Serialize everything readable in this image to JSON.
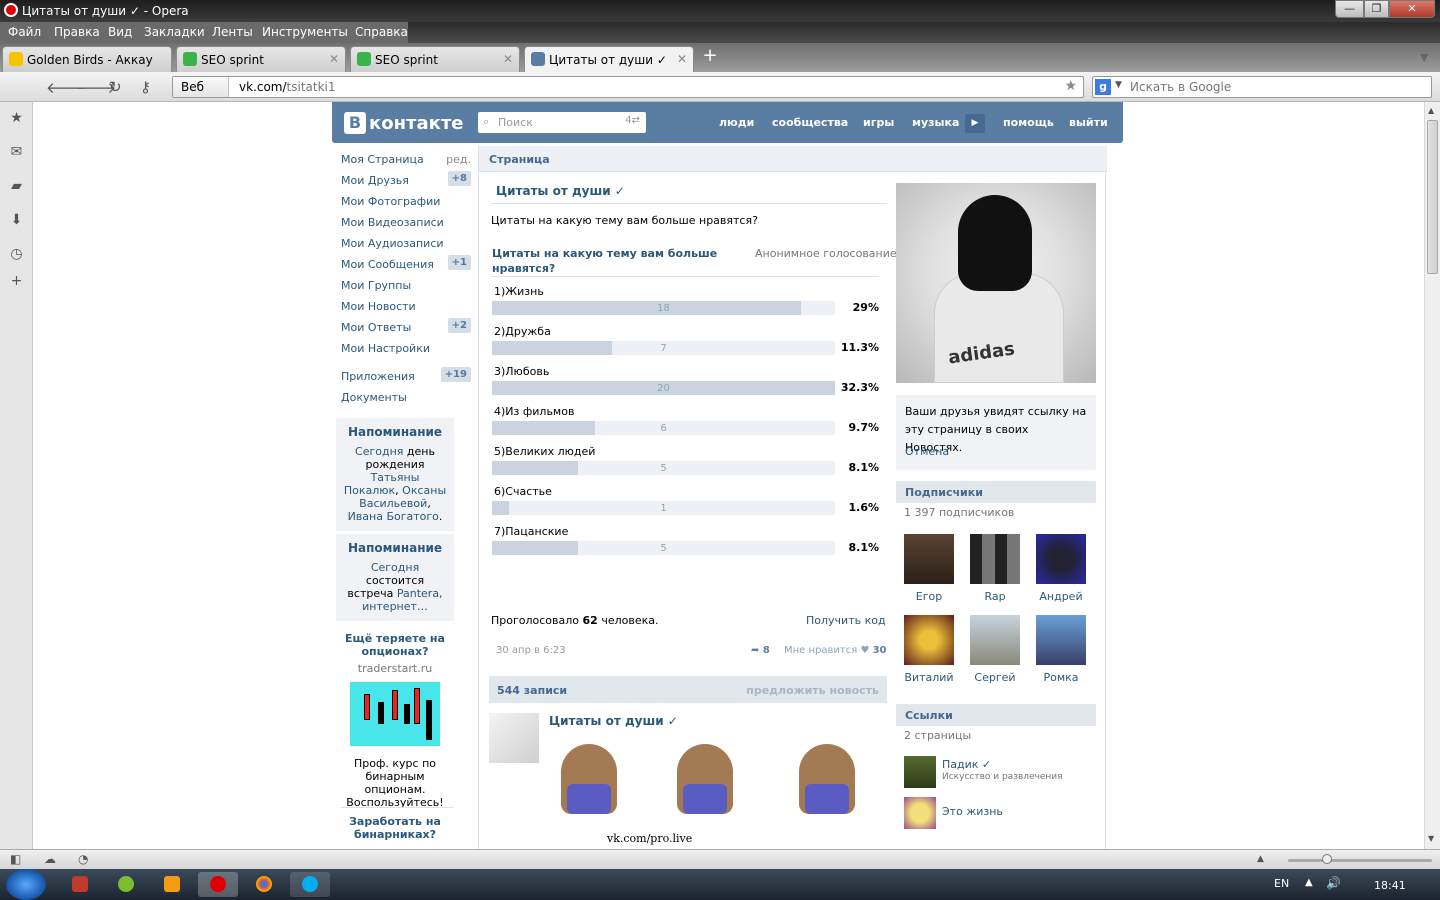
{
  "window": {
    "title": "Цитаты от души ✓ - Opera",
    "min": "—",
    "max": "❐",
    "close": "✕"
  },
  "menu": [
    "Файл",
    "Правка",
    "Вид",
    "Закладки",
    "Ленты",
    "Инструменты",
    "Справка"
  ],
  "tabs": [
    {
      "label": "Golden Birds - Аккаунт...",
      "close": "✕",
      "icon": "golden-birds-favicon"
    },
    {
      "label": "SEO sprint",
      "close": "✕",
      "icon": "seo-sprint-favicon"
    },
    {
      "label": "SEO sprint",
      "close": "✕",
      "icon": "seo-sprint-favicon"
    },
    {
      "label": "Цитаты от души ✓",
      "close": "✕",
      "icon": "vk-favicon"
    }
  ],
  "nav": {
    "back": "🡐",
    "forward": "🡒",
    "reload": "↻",
    "key": "⚷",
    "web_label": "Веб",
    "url_host": "vk.com/",
    "url_path": "tsitatki1",
    "search_placeholder": "Искать в Google",
    "search_engine": "g"
  },
  "vk": {
    "logo_letter": "В",
    "logo_text": "контакте",
    "search_placeholder": "Поиск",
    "nav": [
      "люди",
      "сообщества",
      "игры",
      "музыка",
      "помощь",
      "выйти"
    ],
    "left_nav": [
      {
        "label": "Моя Страница",
        "extra": "ред."
      },
      {
        "label": "Мои Друзья",
        "badge": "+8"
      },
      {
        "label": "Мои Фотографии"
      },
      {
        "label": "Мои Видеозаписи"
      },
      {
        "label": "Мои Аудиозаписи"
      },
      {
        "label": "Мои Сообщения",
        "badge": "+1"
      },
      {
        "label": "Мои Группы"
      },
      {
        "label": "Мои Новости"
      },
      {
        "label": "Мои Ответы",
        "badge": "+2"
      },
      {
        "label": "Мои Настройки"
      },
      {
        "label": "Приложения",
        "badge": "+19"
      },
      {
        "label": "Документы"
      }
    ],
    "reminders": [
      {
        "title": "Напоминание",
        "parts": [
          "Сегодня",
          " день рождения ",
          "Татьяны Покалюк",
          ", ",
          "Оксаны Васильевой",
          ", ",
          "Ивана Богатого",
          "."
        ]
      },
      {
        "title": "Напоминание",
        "parts": [
          "Сегодня",
          " состоится встреча ",
          "Pantera, интернет…"
        ]
      }
    ],
    "ad1": {
      "title": "Ещё теряете на опционах?",
      "domain": "traderstart.ru",
      "text": "Проф. курс по бинарным опционам. Воспользуйтесь!"
    },
    "ad2": {
      "title": "Заработать на бинарниках?"
    },
    "page_header": "Страница",
    "group_name": "Цитаты от души ✓",
    "group_desc": "Цитаты на какую тему вам больше нравятся?",
    "poll": {
      "question": "Цитаты на какую тему вам больше нравятся?",
      "anon": "Анонимное голосование",
      "options": [
        {
          "label": "1)Жизнь",
          "count": 18,
          "percent": "29%",
          "share": 0.9
        },
        {
          "label": "2)Дружба",
          "count": 7,
          "percent": "11.3%",
          "share": 0.35
        },
        {
          "label": "3)Любовь",
          "count": 20,
          "percent": "32.3%",
          "share": 1.0
        },
        {
          "label": "4)Из фильмов",
          "count": 6,
          "percent": "9.7%",
          "share": 0.3
        },
        {
          "label": "5)Великих людей",
          "count": 5,
          "percent": "8.1%",
          "share": 0.25
        },
        {
          "label": "6)Счастье",
          "count": 1,
          "percent": "1.6%",
          "share": 0.05
        },
        {
          "label": "7)Пацанские",
          "count": 5,
          "percent": "8.1%",
          "share": 0.25
        }
      ],
      "voted_prefix": "Проголосовало ",
      "voted_count": "62",
      "voted_suffix": " человека.",
      "get_code": "Получить код",
      "date": "30 апр в 6:23",
      "shares": "8",
      "like_label": "Мне нравится",
      "likes": "30"
    },
    "wall": {
      "count": "544 записи",
      "suggest": "предложить новость",
      "post_author": "Цитаты от души ✓",
      "post_watermark": "vk.com/pro.live"
    },
    "notice": "Ваши друзья увидят ссылку на эту страницу в своих Новостях.",
    "cancel": "Отмена",
    "subscribers": {
      "title": "Подписчики",
      "count": "1 397 подписчиков",
      "people": [
        "Егор",
        "Rap",
        "Андрей",
        "Виталий",
        "Сергей",
        "Ромка"
      ]
    },
    "links": {
      "title": "Ссылки",
      "count": "2 страницы",
      "items": [
        {
          "name": "Падик ✓",
          "desc": "Искусство и развлечения"
        },
        {
          "name": "Это жизнь",
          "desc": ""
        }
      ]
    }
  },
  "taskbar": {
    "lang": "EN",
    "time": "18:41"
  }
}
